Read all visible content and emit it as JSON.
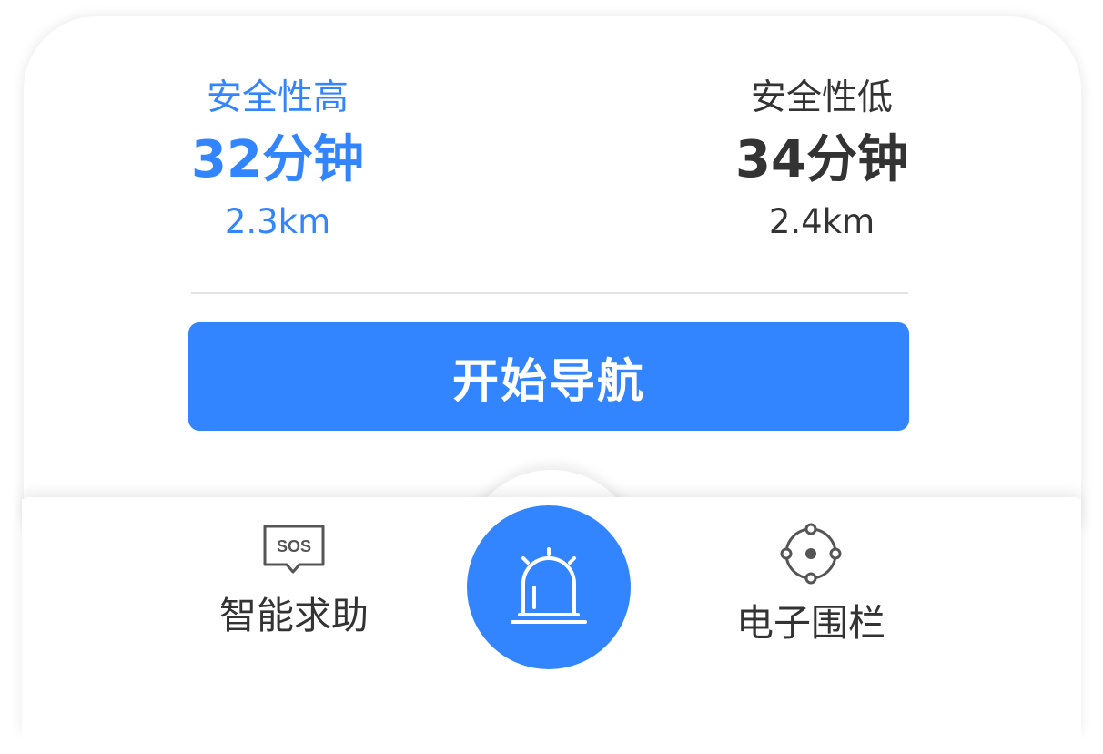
{
  "colors": {
    "accent": "#3385ff",
    "text_dark": "#333333",
    "text_white": "#ffffff",
    "divider": "#e3e3e3"
  },
  "routes": [
    {
      "tag": "安全性高",
      "time": "32分钟",
      "distance": "2.3km",
      "selected": true
    },
    {
      "tag": "安全性低",
      "time": "34分钟",
      "distance": "2.4km",
      "selected": false
    }
  ],
  "actions": {
    "start_navigation": "开始导航"
  },
  "tab_bar": {
    "sos": {
      "label": "智能求助",
      "icon": "sos-message-icon",
      "icon_text": "SOS"
    },
    "alarm": {
      "icon": "alarm-light-icon"
    },
    "fence": {
      "label": "电子围栏",
      "icon": "geofence-target-icon"
    }
  }
}
